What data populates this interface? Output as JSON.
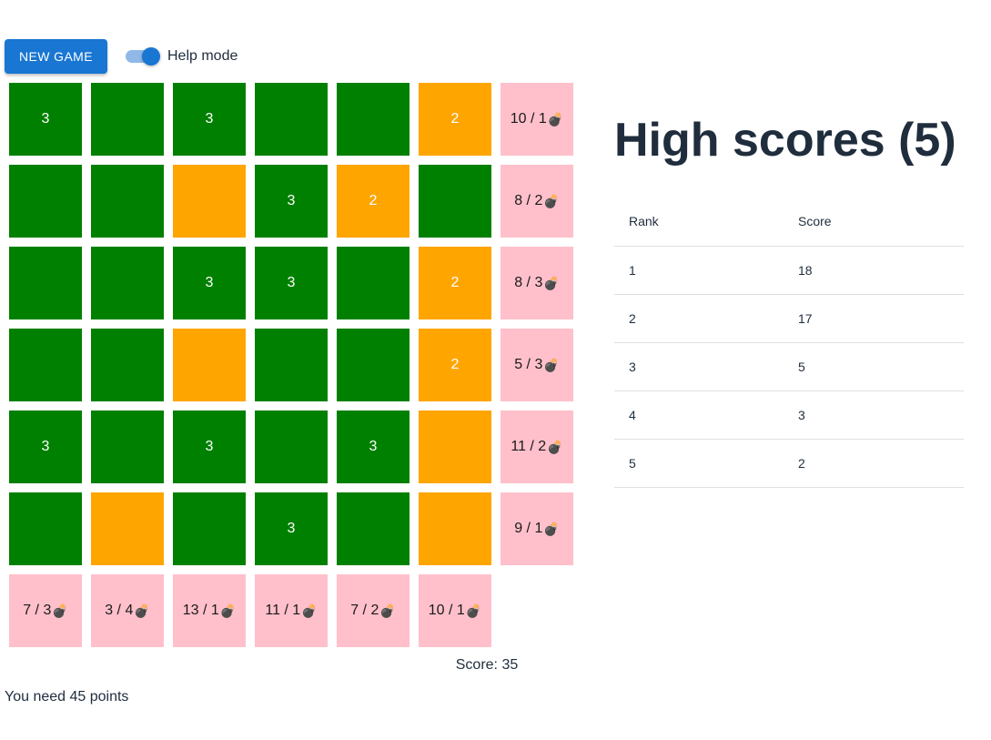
{
  "toolbar": {
    "new_game_label": "NEW GAME",
    "help_mode_label": "Help mode",
    "help_mode_on": true
  },
  "colors": {
    "green": "#008000",
    "orange": "#ffa500",
    "hint": "#ffc0cb",
    "primary": "#1976d2"
  },
  "board": {
    "rows": [
      [
        {
          "type": "green",
          "text": "3"
        },
        {
          "type": "green",
          "text": ""
        },
        {
          "type": "green",
          "text": "3"
        },
        {
          "type": "green",
          "text": ""
        },
        {
          "type": "green",
          "text": ""
        },
        {
          "type": "orange",
          "text": "2"
        },
        {
          "type": "hint",
          "text": "10 / 1",
          "icon": "bomb-icon"
        }
      ],
      [
        {
          "type": "green",
          "text": ""
        },
        {
          "type": "green",
          "text": ""
        },
        {
          "type": "orange",
          "text": ""
        },
        {
          "type": "green",
          "text": "3"
        },
        {
          "type": "orange",
          "text": "2"
        },
        {
          "type": "green",
          "text": ""
        },
        {
          "type": "hint",
          "text": "8 / 2",
          "icon": "bomb-icon"
        }
      ],
      [
        {
          "type": "green",
          "text": ""
        },
        {
          "type": "green",
          "text": ""
        },
        {
          "type": "green",
          "text": "3"
        },
        {
          "type": "green",
          "text": "3"
        },
        {
          "type": "green",
          "text": ""
        },
        {
          "type": "orange",
          "text": "2"
        },
        {
          "type": "hint",
          "text": "8 / 3",
          "icon": "bomb-icon"
        }
      ],
      [
        {
          "type": "green",
          "text": ""
        },
        {
          "type": "green",
          "text": ""
        },
        {
          "type": "orange",
          "text": ""
        },
        {
          "type": "green",
          "text": ""
        },
        {
          "type": "green",
          "text": ""
        },
        {
          "type": "orange",
          "text": "2"
        },
        {
          "type": "hint",
          "text": "5 / 3",
          "icon": "bomb-icon"
        }
      ],
      [
        {
          "type": "green",
          "text": "3"
        },
        {
          "type": "green",
          "text": ""
        },
        {
          "type": "green",
          "text": "3"
        },
        {
          "type": "green",
          "text": ""
        },
        {
          "type": "green",
          "text": "3"
        },
        {
          "type": "orange",
          "text": ""
        },
        {
          "type": "hint",
          "text": "11 / 2",
          "icon": "bomb-icon"
        }
      ],
      [
        {
          "type": "green",
          "text": ""
        },
        {
          "type": "orange",
          "text": ""
        },
        {
          "type": "green",
          "text": ""
        },
        {
          "type": "green",
          "text": "3"
        },
        {
          "type": "green",
          "text": ""
        },
        {
          "type": "orange",
          "text": ""
        },
        {
          "type": "hint",
          "text": "9 / 1",
          "icon": "bomb-icon"
        }
      ],
      [
        {
          "type": "hint",
          "text": "7 / 3",
          "icon": "bomb-icon"
        },
        {
          "type": "hint",
          "text": "3 / 4",
          "icon": "bomb-icon"
        },
        {
          "type": "hint",
          "text": "13 / 1",
          "icon": "bomb-icon"
        },
        {
          "type": "hint",
          "text": "11 / 1",
          "icon": "bomb-icon"
        },
        {
          "type": "hint",
          "text": "7 / 2",
          "icon": "bomb-icon"
        },
        {
          "type": "hint",
          "text": "10 / 1",
          "icon": "bomb-icon"
        }
      ]
    ]
  },
  "status": {
    "score_text": "Score: 35",
    "need_text": "You need 45 points"
  },
  "high_scores": {
    "title": "High scores (5)",
    "columns": [
      "Rank",
      "Score"
    ],
    "rows": [
      [
        "1",
        "18"
      ],
      [
        "2",
        "17"
      ],
      [
        "3",
        "5"
      ],
      [
        "4",
        "3"
      ],
      [
        "5",
        "2"
      ]
    ]
  }
}
